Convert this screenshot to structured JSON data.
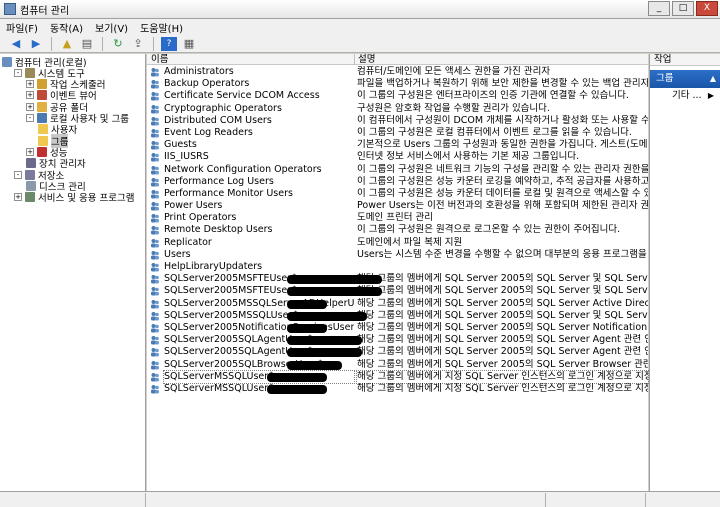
{
  "window": {
    "title": "컴퓨터 관리",
    "buttons": [
      "_",
      "□",
      "X"
    ]
  },
  "menu": [
    "파일(F)",
    "동작(A)",
    "보기(V)",
    "도움말(H)"
  ],
  "toolbar": [
    "back-icon",
    "forward-icon",
    "up-icon",
    "show-hide-tree-icon",
    "refresh-icon",
    "export-icon",
    "help-icon",
    "properties-icon"
  ],
  "tree": [
    {
      "label": "컴퓨터 관리(로컬)",
      "icon": "computer-icon",
      "level": 0,
      "expander": ""
    },
    {
      "label": "시스템 도구",
      "icon": "tools-icon",
      "level": 1,
      "expander": "-"
    },
    {
      "label": "작업 스케줄러",
      "icon": "clock-icon",
      "level": 2,
      "expander": "+"
    },
    {
      "label": "이벤트 뷰어",
      "icon": "event-viewer-icon",
      "level": 2,
      "expander": "+"
    },
    {
      "label": "공유 폴더",
      "icon": "shared-folder-icon",
      "level": 2,
      "expander": "+"
    },
    {
      "label": "로컬 사용자 및 그룹",
      "icon": "users-icon",
      "level": 2,
      "expander": "-"
    },
    {
      "label": "사용자",
      "icon": "folder-icon",
      "level": 3,
      "expander": ""
    },
    {
      "label": "그룹",
      "icon": "folder-icon",
      "level": 3,
      "expander": "",
      "selected": true
    },
    {
      "label": "성능",
      "icon": "performance-icon",
      "level": 2,
      "expander": "+"
    },
    {
      "label": "장치 관리자",
      "icon": "device-manager-icon",
      "level": 2,
      "expander": ""
    },
    {
      "label": "저장소",
      "icon": "storage-icon",
      "level": 1,
      "expander": "-"
    },
    {
      "label": "디스크 관리",
      "icon": "disk-icon",
      "level": 2,
      "expander": ""
    },
    {
      "label": "서비스 및 응용 프로그램",
      "icon": "services-icon",
      "level": 1,
      "expander": "+"
    }
  ],
  "columns": {
    "name": "이름",
    "description": "설명"
  },
  "groups": [
    {
      "name": "Administrators",
      "description": "컴퓨터/도메인에 모든 액세스 권한을 가진 관리자"
    },
    {
      "name": "Backup Operators",
      "description": "파일을 백업하거나 복원하기 위해 보안 제한을 변경할 수 있는 백업 관리자"
    },
    {
      "name": "Certificate Service DCOM Access",
      "description": "이 그룹의 구성원은 엔터프라이즈의 인증 기관에 연결할 수 있습니다."
    },
    {
      "name": "Cryptographic Operators",
      "description": "구성원은 암호화 작업을 수행할 권리가 있습니다."
    },
    {
      "name": "Distributed COM Users",
      "description": "이 컴퓨터에서 구성원이 DCOM 개체를 시작하거나 활성화 또는 사용할 수"
    },
    {
      "name": "Event Log Readers",
      "description": "이 그룹의 구성원은 로컬 컴퓨터에서 이벤트 로그를 읽을 수 있습니다."
    },
    {
      "name": "Guests",
      "description": "기본적으로 Users 그룹의 구성원과 동일한 권한을 가집니다. 게스트(도메인의 제한"
    },
    {
      "name": "IIS_IUSRS",
      "description": "인터넷 정보 서비스에서 사용하는 기본 제공 그룹입니다."
    },
    {
      "name": "Network Configuration Operators",
      "description": "이 그룹의 구성원은 네트워크 기능의 구성을 관리할 수 있는 관리자 권한을"
    },
    {
      "name": "Performance Log Users",
      "description": "이 그룹의 구성원은 성능 카운터 로깅을 예약하고, 추적 공급자를 사용하고"
    },
    {
      "name": "Performance Monitor Users",
      "description": "이 그룹의 구성원은 성능 카운터 데이터를 로컬 및 원격으로 액세스할 수 있"
    },
    {
      "name": "Power Users",
      "description": "Power Users는 이전 버전과의 호환성을 위해 포함되며 제한된 관리자 권한"
    },
    {
      "name": "Print Operators",
      "description": "도메인 프린터 관리"
    },
    {
      "name": "Remote Desktop Users",
      "description": "이 그룹의 구성원은 원격으로 로그온할 수 있는 권한이 주어집니다."
    },
    {
      "name": "Replicator",
      "description": "도메인에서 파일 복제 지원"
    },
    {
      "name": "Users",
      "description": "Users는 시스템 수준 변경을 수행할 수 없으며 대부분의 응용 프로그램을 실"
    },
    {
      "name": "HelpLibraryUpdaters",
      "description": ""
    },
    {
      "name": "SQLServer2005MSFTEUser$",
      "description": "해당 그룹의 멤버에게 SQL Server 2005의 SQL Server 및 SQL Server 전체",
      "redact": 95
    },
    {
      "name": "SQLServer2005MSFTEUser$",
      "description": "해당 그룹의 멤버에게 SQL Server 2005의 SQL Server 및 SQL Server 전체",
      "redact": 95
    },
    {
      "name": "SQLServer2005MSSQLServerADHelperUser$",
      "description": "해당 그룹의 멤버에게 SQL Server 2005의 SQL Server Active Directory He",
      "redact": 40
    },
    {
      "name": "SQLServer2005MSSQLUser$",
      "description": "해당 그룹의 멤버에게 SQL Server 2005의 SQL Server 및 SQL Server 전체",
      "redact": 80
    },
    {
      "name": "SQLServer2005NotificationServicesUser$",
      "description": "해당 그룹의 멤버에게 SQL Server 2005의 SQL Server Notification Service",
      "redact": 40
    },
    {
      "name": "SQLServer2005SQLAgentUser$",
      "description": "해당 그룹의 멤버에게 SQL Server 2005의 SQL Server Agent 관련 인스턴스",
      "redact": 75
    },
    {
      "name": "SQLServer2005SQLAgentUser$",
      "description": "해당 그룹의 멤버에게 SQL Server 2005의 SQL Server Agent 관련 인스턴스",
      "redact": 75
    },
    {
      "name": "SQLServer2005SQLBrowserUser$",
      "description": "해당 그룹의 멤버에게 SQL Server 2005의 SQL Server Browser 관련 인스턴",
      "redact": 55
    },
    {
      "name": "SQLServerMSSQLUser$",
      "description": "해당 그룹의 멤버에게 지정 SQL Server 인스턴스의 로그인 계정으로 지정",
      "redact": 60,
      "focus": true
    },
    {
      "name": "SQLServerMSSQLUser$",
      "description": "해당 그룹의 멤버에게 지정 SQL Server 인스턴스의 로그인 계정으로 지정",
      "redact": 60
    }
  ],
  "actions": {
    "header": "작업",
    "group_title": "그룹",
    "more": "기타 ..."
  },
  "colors": {
    "selection": "#1a56a8",
    "background": "#d4d0c8"
  }
}
